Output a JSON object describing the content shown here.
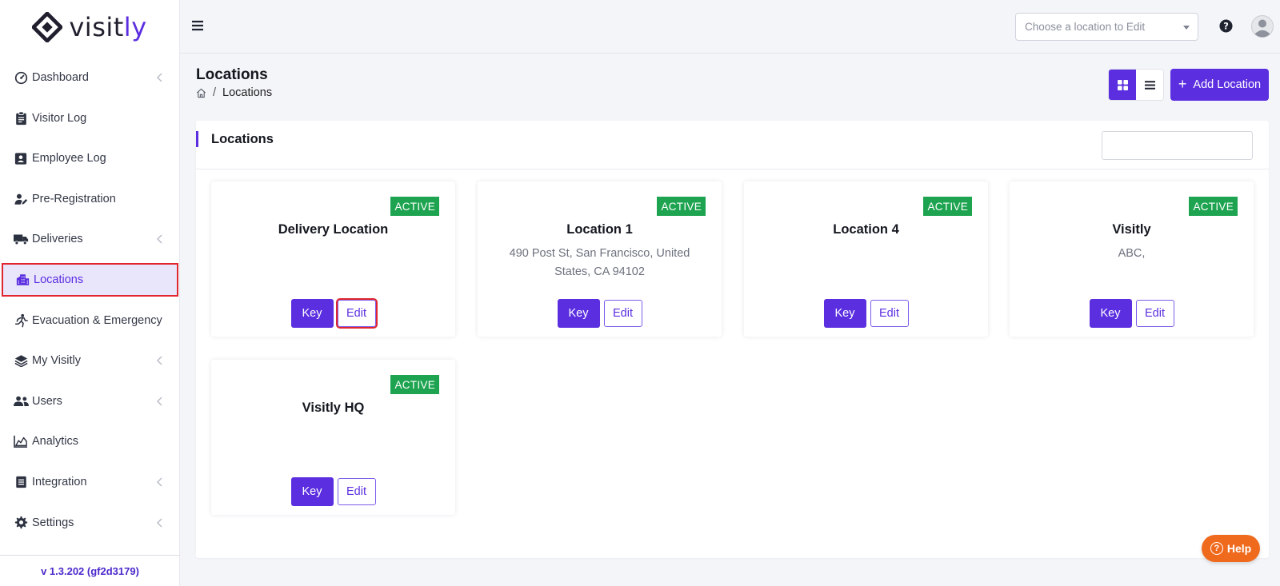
{
  "app": {
    "logo_text_main": "visit",
    "logo_text_accent": "ly",
    "version": "v 1.3.202 (gf2d3179)"
  },
  "sidebar": {
    "items": [
      {
        "label": "Dashboard",
        "icon": "gauge-icon",
        "has_chevron": true
      },
      {
        "label": "Visitor Log",
        "icon": "clipboard-icon",
        "has_chevron": false
      },
      {
        "label": "Employee Log",
        "icon": "badge-icon",
        "has_chevron": false
      },
      {
        "label": "Pre-Registration",
        "icon": "user-pen-icon",
        "has_chevron": false
      },
      {
        "label": "Deliveries",
        "icon": "truck-icon",
        "has_chevron": true
      },
      {
        "label": "Locations",
        "icon": "building-icon",
        "has_chevron": false,
        "active": true
      },
      {
        "label": "Evacuation & Emergency",
        "icon": "running-person-icon",
        "has_chevron": false
      },
      {
        "label": "My Visitly",
        "icon": "layers-icon",
        "has_chevron": true
      },
      {
        "label": "Users",
        "icon": "users-icon",
        "has_chevron": true
      },
      {
        "label": "Analytics",
        "icon": "chart-area-icon",
        "has_chevron": false
      },
      {
        "label": "Integration",
        "icon": "list-box-icon",
        "has_chevron": true
      },
      {
        "label": "Settings",
        "icon": "gear-icon",
        "has_chevron": true
      }
    ]
  },
  "topbar": {
    "location_select_placeholder": "Choose a location to Edit"
  },
  "page": {
    "title": "Locations",
    "breadcrumb_current": "Locations",
    "breadcrumb_sep": "/",
    "add_button_label": "Add Location",
    "add_button_icon": "+"
  },
  "panel": {
    "title": "Locations",
    "search_value": ""
  },
  "cards": [
    {
      "name": "Delivery Location",
      "address": "",
      "status": "ACTIVE",
      "key_label": "Key",
      "edit_label": "Edit",
      "edit_highlighted": true
    },
    {
      "name": "Location 1",
      "address": "490 Post St, San Francisco, United States, CA 94102",
      "status": "ACTIVE",
      "key_label": "Key",
      "edit_label": "Edit"
    },
    {
      "name": "Location 4",
      "address": "",
      "status": "ACTIVE",
      "key_label": "Key",
      "edit_label": "Edit"
    },
    {
      "name": "Visitly",
      "address": "ABC,",
      "status": "ACTIVE",
      "key_label": "Key",
      "edit_label": "Edit"
    },
    {
      "name": "Visitly HQ",
      "address": "",
      "status": "ACTIVE",
      "key_label": "Key",
      "edit_label": "Edit"
    }
  ],
  "help_fab": {
    "label": "Help",
    "icon": "?"
  },
  "colors": {
    "brand": "#5b2ee0",
    "active_badge": "#1ea450",
    "highlight": "#e0262f",
    "help": "#f06a1d"
  }
}
